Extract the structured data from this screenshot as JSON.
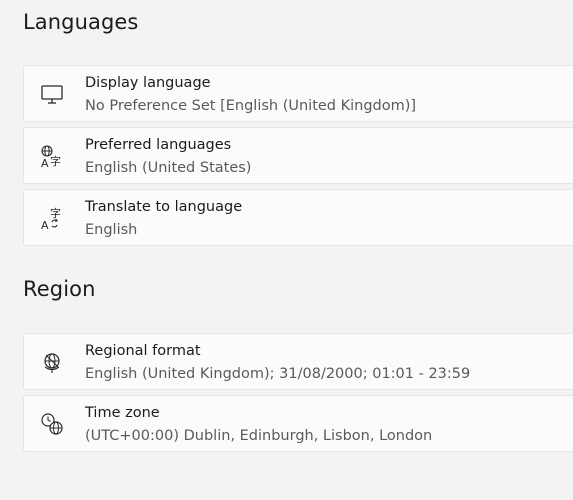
{
  "languages": {
    "title": "Languages",
    "items": [
      {
        "label": "Display language",
        "value": "No Preference Set [English (United Kingdom)]",
        "icon": "monitor-icon"
      },
      {
        "label": "Preferred languages",
        "value": "English (United States)",
        "icon": "language-icon"
      },
      {
        "label": "Translate to language",
        "value": "English",
        "icon": "translate-icon"
      }
    ]
  },
  "region": {
    "title": "Region",
    "items": [
      {
        "label": "Regional format",
        "value": "English (United Kingdom); 31/08/2000; 01:01 - 23:59",
        "icon": "regional-format-icon"
      },
      {
        "label": "Time zone",
        "value": "(UTC+00:00) Dublin, Edinburgh, Lisbon, London",
        "icon": "time-zone-icon"
      }
    ]
  }
}
